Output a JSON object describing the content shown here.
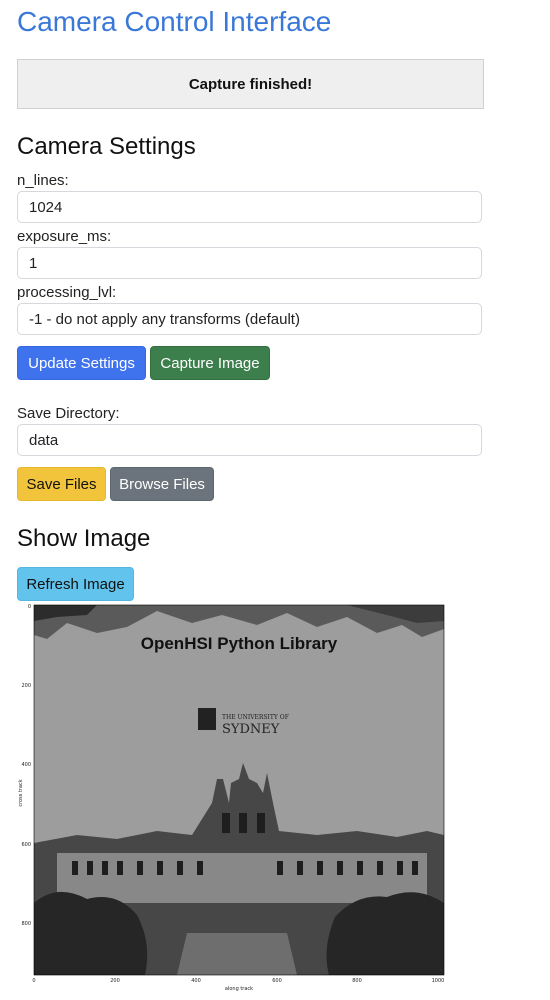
{
  "app": {
    "title": "Camera Control Interface"
  },
  "status": {
    "message": "Capture finished!"
  },
  "camera_settings": {
    "heading": "Camera Settings",
    "fields": [
      {
        "label": "n_lines:",
        "value": "1024"
      },
      {
        "label": "exposure_ms:",
        "value": "1"
      },
      {
        "label": "processing_lvl:",
        "value": "-1 - do not apply any transforms (default)"
      }
    ],
    "update_label": "Update Settings",
    "capture_label": "Capture Image"
  },
  "save": {
    "label": "Save Directory:",
    "value": "data",
    "save_label": "Save Files",
    "browse_label": "Browse Files"
  },
  "show_image": {
    "heading": "Show Image",
    "refresh_label": "Refresh Image"
  },
  "figure": {
    "banner": "OpenHSI Python Library",
    "logo_line1": "THE UNIVERSITY OF",
    "logo_line2": "SYDNEY",
    "x_ticks": [
      "0",
      "200",
      "400",
      "600",
      "800",
      "1000"
    ],
    "y_ticks": [
      "0",
      "200",
      "400",
      "600",
      "800"
    ],
    "xlabel": "along track",
    "ylabel": "cross track"
  },
  "colors": {
    "title": "#3a78d8",
    "primary": "#3f73ee",
    "success": "#3d7f4c",
    "warning": "#f2c43b",
    "secondary": "#6b747d",
    "info": "#62c3ec"
  }
}
